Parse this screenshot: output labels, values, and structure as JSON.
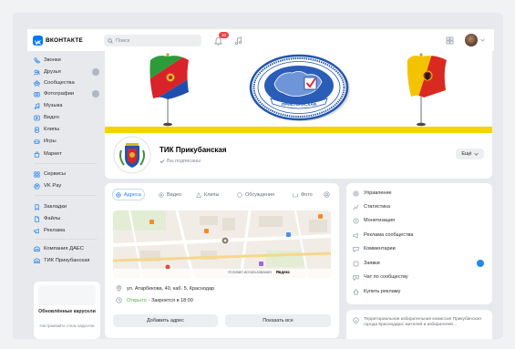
{
  "header": {
    "logo_text": "ВКОНТАКТЕ",
    "search_placeholder": "Поиск",
    "notifications_badge": "10"
  },
  "sidebar": {
    "items": [
      {
        "label": "Звонки",
        "icon": "phone-icon"
      },
      {
        "label": "Друзья",
        "icon": "friends-icon",
        "badge": true
      },
      {
        "label": "Сообщества",
        "icon": "community-icon"
      },
      {
        "label": "Фотографии",
        "icon": "photo-icon",
        "badge": true
      },
      {
        "label": "Музыка",
        "icon": "music-icon"
      },
      {
        "label": "Видео",
        "icon": "video-icon"
      },
      {
        "label": "Клипы",
        "icon": "clips-icon"
      },
      {
        "label": "Игры",
        "icon": "games-icon"
      },
      {
        "label": "Маркет",
        "icon": "market-icon"
      },
      {
        "label": "Сервисы",
        "icon": "services-icon"
      },
      {
        "label": "VK Pay",
        "icon": "vkpay-icon"
      },
      {
        "label": "Закладки",
        "icon": "bookmark-icon"
      },
      {
        "label": "Файлы",
        "icon": "file-icon"
      },
      {
        "label": "Реклама",
        "icon": "ads-icon"
      },
      {
        "label": "Компания ДАЕС",
        "icon": "group-icon"
      },
      {
        "label": "ТИК Прикубанская",
        "icon": "group-icon"
      }
    ],
    "promo": {
      "title": "Обновлённые карусели",
      "text": "Настраивайте стиль карусели"
    }
  },
  "community": {
    "name": "ТИК Прикубанская",
    "status": "Вы подписаны",
    "more_button": "Ещё",
    "emblem_text": "ПРИКУБАНСКАЯ"
  },
  "main": {
    "tabs": [
      {
        "label": "Адреса",
        "icon": "at-icon",
        "active": true
      },
      {
        "label": "Видео",
        "icon": "video-icon"
      },
      {
        "label": "Клипы",
        "icon": "clips-icon"
      },
      {
        "label": "Обсуждения",
        "icon": "comment-icon"
      },
      {
        "label": "Фото",
        "icon": "photo-icon"
      }
    ],
    "map": {
      "terms": "Условия использования",
      "provider": "Яндекс"
    },
    "address": "ул. Атарбекова, 40, каб. 5, Краснодар",
    "hours_status": "Открыто",
    "hours_text": "· Закроется в 18:00",
    "add_address_button": "Добавить адрес",
    "show_all_button": "Показать все"
  },
  "admin_menu": [
    {
      "label": "Управление",
      "icon": "gear-icon"
    },
    {
      "label": "Статистика",
      "icon": "stats-icon"
    },
    {
      "label": "Монетизация",
      "icon": "coin-icon"
    },
    {
      "label": "Реклама сообщества",
      "icon": "megaphone-icon"
    },
    {
      "label": "Комментарии",
      "icon": "comment-icon"
    },
    {
      "label": "Заявки",
      "icon": "requests-icon",
      "badge": true
    },
    {
      "label": "Чат по сообществу",
      "icon": "chat-icon"
    },
    {
      "label": "Купить рекламу",
      "icon": "ads-icon"
    }
  ],
  "description": "Территориальная избирательная комиссия Прикубанская города Краснодара: жителей и избирателей…",
  "colors": {
    "accent": "#2688eb",
    "brand": "#0077ff",
    "open_green": "#4bb34b",
    "badge_red": "#e64646",
    "cover_stripe": "#f5d300"
  }
}
